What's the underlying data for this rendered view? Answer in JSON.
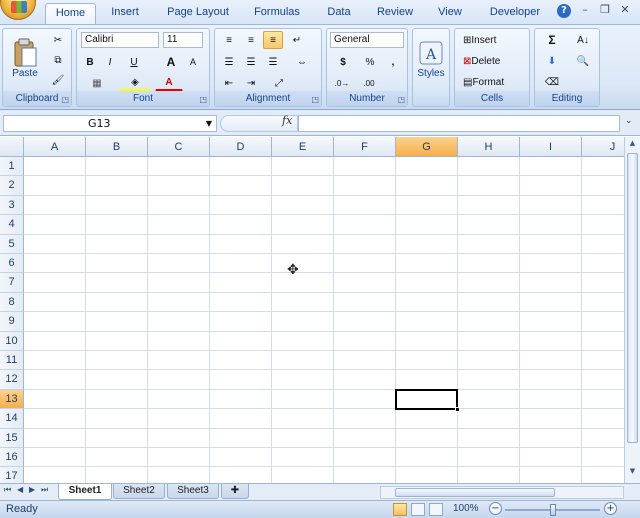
{
  "ribbon_tabs": [
    "Home",
    "Insert",
    "Page Layout",
    "Formulas",
    "Data",
    "Review",
    "View",
    "Developer"
  ],
  "active_tab": "Home",
  "groups": {
    "clipboard": {
      "label": "Clipboard",
      "paste": "Paste"
    },
    "font": {
      "label": "Font",
      "font_name": "Calibri",
      "font_size": "11",
      "bold": "B",
      "italic": "I",
      "underline": "U",
      "grow": "A",
      "font_color": "A"
    },
    "alignment": {
      "label": "Alignment"
    },
    "number": {
      "label": "Number",
      "format": "General",
      "currency": "$",
      "percent": "%",
      "comma": ","
    },
    "styles": {
      "label": "Styles"
    },
    "cells": {
      "label": "Cells",
      "insert": "Insert",
      "delete": "Delete",
      "format": "Format"
    },
    "editing": {
      "label": "Editing",
      "sum": "Σ"
    }
  },
  "name_box": "G13",
  "fx_label": "fx",
  "formula_value": "",
  "columns": [
    "A",
    "B",
    "C",
    "D",
    "E",
    "F",
    "G",
    "H",
    "I",
    "J"
  ],
  "selected_column": "G",
  "rows": [
    "1",
    "2",
    "3",
    "4",
    "5",
    "6",
    "7",
    "8",
    "9",
    "10",
    "11",
    "12",
    "13",
    "14",
    "15",
    "16",
    "17"
  ],
  "selected_row": "13",
  "sheets": [
    "Sheet1",
    "Sheet2",
    "Sheet3"
  ],
  "active_sheet": "Sheet1",
  "status": "Ready",
  "zoom": "100%",
  "zoom_level_percent": 100,
  "icons": [
    "office-button",
    "help-icon",
    "paste-icon",
    "cut-icon",
    "copy-icon",
    "format-painter-icon",
    "styles-icon",
    "sum-icon",
    "sort-filter-icon",
    "find-select-icon",
    "cursor-icon"
  ]
}
